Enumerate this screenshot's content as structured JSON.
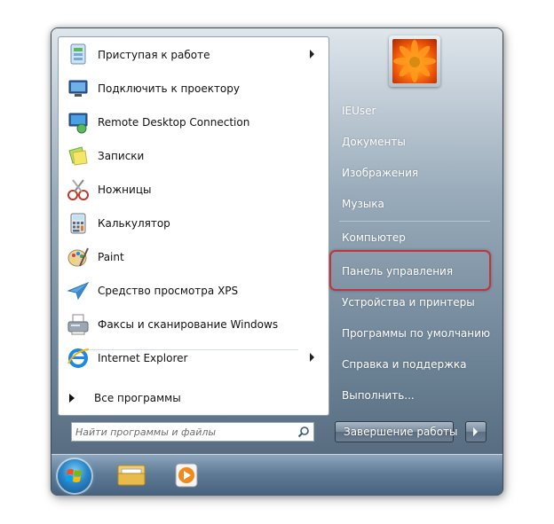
{
  "programs": [
    {
      "label": "Приступая к работе",
      "icon": "getting-started-icon",
      "has_arrow": true
    },
    {
      "label": "Подключить к проектору",
      "icon": "projector-icon",
      "has_arrow": false
    },
    {
      "label": "Remote Desktop Connection",
      "icon": "remote-desktop-icon",
      "has_arrow": false
    },
    {
      "label": "Записки",
      "icon": "sticky-notes-icon",
      "has_arrow": false
    },
    {
      "label": "Ножницы",
      "icon": "scissors-icon",
      "has_arrow": false
    },
    {
      "label": "Калькулятор",
      "icon": "calculator-icon",
      "has_arrow": false
    },
    {
      "label": "Paint",
      "icon": "paint-palette-icon",
      "has_arrow": false
    },
    {
      "label": "Средство просмотра XPS",
      "icon": "xps-viewer-icon",
      "has_arrow": false
    },
    {
      "label": "Факсы и сканирование Windows",
      "icon": "fax-scan-icon",
      "has_arrow": false
    },
    {
      "label": "Internet Explorer",
      "icon": "internet-explorer-icon",
      "has_arrow": true
    }
  ],
  "all_programs_label": "Все программы",
  "search": {
    "placeholder": "Найти программы и файлы"
  },
  "right_panel": {
    "items": [
      {
        "label": "IEUser"
      },
      {
        "label": "Документы"
      },
      {
        "label": "Изображения"
      },
      {
        "label": "Музыка"
      },
      {
        "label": "Компьютер"
      },
      {
        "label": "Панель управления"
      },
      {
        "label": "Устройства и принтеры"
      },
      {
        "label": "Программы по умолчанию"
      },
      {
        "label": "Справка и поддержка"
      },
      {
        "label": "Выполнить..."
      }
    ],
    "highlighted_item": "Панель управления"
  },
  "shutdown": {
    "label": "Завершение работы"
  },
  "colors": {
    "highlight_border": "#c2333a",
    "panel_text": "#ffffff"
  }
}
